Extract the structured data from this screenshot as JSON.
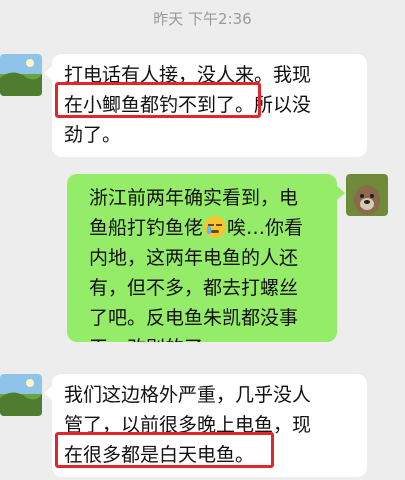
{
  "timestamp": "昨天 下午2:36",
  "messages": [
    {
      "side": "left",
      "lines": [
        "打电话有人接，没人来。我现",
        "在小鲫鱼都钓不到了。所以没",
        "劲了。"
      ]
    },
    {
      "side": "right",
      "line1": "浙江前两年确实看到，电",
      "line2_a": "鱼船打钓鱼佬",
      "emoji": "facepalm-tears-emoji",
      "line2_b": "唉…你看",
      "rest": [
        "内地，这两年电鱼的人还",
        "有，但不多，都去打螺丝",
        "了吧。反电鱼朱凯都没事",
        "干，改别的了"
      ]
    },
    {
      "side": "left",
      "lines": [
        "我们这边格外严重，几乎没人",
        "管了，以前很多晚上电鱼，现",
        "在很多都是白天电鱼。"
      ]
    }
  ],
  "colors": {
    "background": "#ededed",
    "bubble_left": "#ffffff",
    "bubble_right": "#95ec69",
    "highlight": "#e3262c"
  }
}
